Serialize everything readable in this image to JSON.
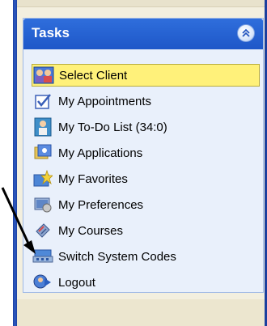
{
  "panel": {
    "title": "Tasks",
    "collapse_icon": "double-chevron-up-icon",
    "colors": {
      "header": "#1e57c8",
      "pane_bg": "#e9f0fb",
      "selected_bg": "#fff17a",
      "frame_bar": "#1b3f9e"
    }
  },
  "tasks": [
    {
      "label": "Select Client",
      "icon": "client-group-icon",
      "selected": true
    },
    {
      "label": "My Appointments",
      "icon": "checkbox-check-icon",
      "selected": false
    },
    {
      "label": "My To-Do List (34:0)",
      "icon": "person-todo-icon",
      "selected": false
    },
    {
      "label": "My Applications",
      "icon": "applications-icon",
      "selected": false
    },
    {
      "label": "My Favorites",
      "icon": "star-favorites-icon",
      "selected": false
    },
    {
      "label": "My Preferences",
      "icon": "preferences-icon",
      "selected": false
    },
    {
      "label": "My Courses",
      "icon": "courses-icon",
      "selected": false
    },
    {
      "label": "Switch System Codes",
      "icon": "switch-network-icon",
      "selected": false
    },
    {
      "label": "Logout",
      "icon": "logout-icon",
      "selected": false
    }
  ],
  "annotation": {
    "arrow_target": "Switch System Codes",
    "arrow_color": "#000000"
  }
}
